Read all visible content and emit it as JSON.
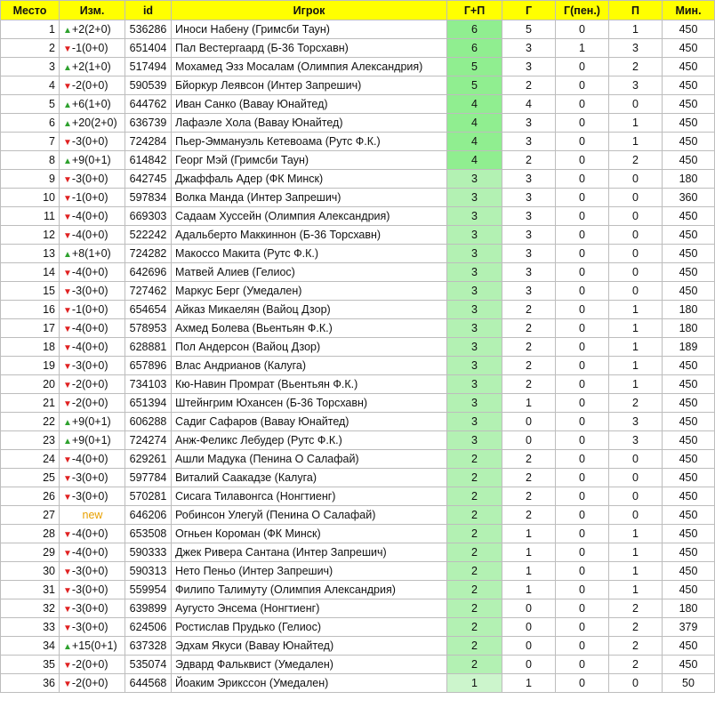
{
  "colors": {
    "header_bg": "#ffff00",
    "gp_high": "#90ee90",
    "gp_mid": "#b3f1b3",
    "gp_low": "#ccf5cc",
    "up": "#2ea12e",
    "down": "#e02020",
    "new": "#e8a000"
  },
  "headers": [
    "Место",
    "Изм.",
    "id",
    "Игрок",
    "Г+П",
    "Г",
    "Г(пен.)",
    "П",
    "Мин."
  ],
  "rows": [
    {
      "place": "1",
      "dir": "up",
      "chg": "+2(2+0)",
      "id": "536286",
      "player": "Иноси Набену (Гримсби Таун)",
      "gp": "6",
      "g": "5",
      "pen": "0",
      "a": "1",
      "min": "450"
    },
    {
      "place": "2",
      "dir": "down",
      "chg": "-1(0+0)",
      "id": "651404",
      "player": "Пал Вестергаард (Б-36 Торсхавн)",
      "gp": "6",
      "g": "3",
      "pen": "1",
      "a": "3",
      "min": "450"
    },
    {
      "place": "3",
      "dir": "up",
      "chg": "+2(1+0)",
      "id": "517494",
      "player": "Мохамед Эзз Мосалам (Олимпия Александрия)",
      "gp": "5",
      "g": "3",
      "pen": "0",
      "a": "2",
      "min": "450"
    },
    {
      "place": "4",
      "dir": "down",
      "chg": "-2(0+0)",
      "id": "590539",
      "player": "Бйоркур Леявсон (Интер Запрешич)",
      "gp": "5",
      "g": "2",
      "pen": "0",
      "a": "3",
      "min": "450"
    },
    {
      "place": "5",
      "dir": "up",
      "chg": "+6(1+0)",
      "id": "644762",
      "player": "Иван Санко (Вавау Юнайтед)",
      "gp": "4",
      "g": "4",
      "pen": "0",
      "a": "0",
      "min": "450"
    },
    {
      "place": "6",
      "dir": "up",
      "chg": "+20(2+0)",
      "id": "636739",
      "player": "Лафаэле Хола (Вавау Юнайтед)",
      "gp": "4",
      "g": "3",
      "pen": "0",
      "a": "1",
      "min": "450"
    },
    {
      "place": "7",
      "dir": "down",
      "chg": "-3(0+0)",
      "id": "724284",
      "player": "Пьер-Эммануэль Кетевоама (Рутс Ф.К.)",
      "gp": "4",
      "g": "3",
      "pen": "0",
      "a": "1",
      "min": "450"
    },
    {
      "place": "8",
      "dir": "up",
      "chg": "+9(0+1)",
      "id": "614842",
      "player": "Георг Мэй (Гримсби Таун)",
      "gp": "4",
      "g": "2",
      "pen": "0",
      "a": "2",
      "min": "450"
    },
    {
      "place": "9",
      "dir": "down",
      "chg": "-3(0+0)",
      "id": "642745",
      "player": "Джаффаль Адер (ФК Минск)",
      "gp": "3",
      "g": "3",
      "pen": "0",
      "a": "0",
      "min": "180"
    },
    {
      "place": "10",
      "dir": "down",
      "chg": "-1(0+0)",
      "id": "597834",
      "player": "Волка Манда (Интер Запрешич)",
      "gp": "3",
      "g": "3",
      "pen": "0",
      "a": "0",
      "min": "360"
    },
    {
      "place": "11",
      "dir": "down",
      "chg": "-4(0+0)",
      "id": "669303",
      "player": "Садаам Хуссейн (Олимпия Александрия)",
      "gp": "3",
      "g": "3",
      "pen": "0",
      "a": "0",
      "min": "450"
    },
    {
      "place": "12",
      "dir": "down",
      "chg": "-4(0+0)",
      "id": "522242",
      "player": "Адальберто Маккиннон (Б-36 Торсхавн)",
      "gp": "3",
      "g": "3",
      "pen": "0",
      "a": "0",
      "min": "450"
    },
    {
      "place": "13",
      "dir": "up",
      "chg": "+8(1+0)",
      "id": "724282",
      "player": "Макоссо Макита (Рутс Ф.К.)",
      "gp": "3",
      "g": "3",
      "pen": "0",
      "a": "0",
      "min": "450"
    },
    {
      "place": "14",
      "dir": "down",
      "chg": "-4(0+0)",
      "id": "642696",
      "player": "Матвей Алиев (Гелиос)",
      "gp": "3",
      "g": "3",
      "pen": "0",
      "a": "0",
      "min": "450"
    },
    {
      "place": "15",
      "dir": "down",
      "chg": "-3(0+0)",
      "id": "727462",
      "player": "Маркус Берг (Умедален)",
      "gp": "3",
      "g": "3",
      "pen": "0",
      "a": "0",
      "min": "450"
    },
    {
      "place": "16",
      "dir": "down",
      "chg": "-1(0+0)",
      "id": "654654",
      "player": "Айказ Микаелян (Вайоц Дзор)",
      "gp": "3",
      "g": "2",
      "pen": "0",
      "a": "1",
      "min": "180"
    },
    {
      "place": "17",
      "dir": "down",
      "chg": "-4(0+0)",
      "id": "578953",
      "player": "Ахмед Болева (Вьентьян Ф.К.)",
      "gp": "3",
      "g": "2",
      "pen": "0",
      "a": "1",
      "min": "180"
    },
    {
      "place": "18",
      "dir": "down",
      "chg": "-4(0+0)",
      "id": "628881",
      "player": "Пол Андерсон (Вайоц Дзор)",
      "gp": "3",
      "g": "2",
      "pen": "0",
      "a": "1",
      "min": "189"
    },
    {
      "place": "19",
      "dir": "down",
      "chg": "-3(0+0)",
      "id": "657896",
      "player": "Влас Андрианов (Калуга)",
      "gp": "3",
      "g": "2",
      "pen": "0",
      "a": "1",
      "min": "450"
    },
    {
      "place": "20",
      "dir": "down",
      "chg": "-2(0+0)",
      "id": "734103",
      "player": "Кю-Навин Промрат (Вьентьян Ф.К.)",
      "gp": "3",
      "g": "2",
      "pen": "0",
      "a": "1",
      "min": "450"
    },
    {
      "place": "21",
      "dir": "down",
      "chg": "-2(0+0)",
      "id": "651394",
      "player": "Штейнгрим Юхансен (Б-36 Торсхавн)",
      "gp": "3",
      "g": "1",
      "pen": "0",
      "a": "2",
      "min": "450"
    },
    {
      "place": "22",
      "dir": "up",
      "chg": "+9(0+1)",
      "id": "606288",
      "player": "Садиг Сафаров (Вавау Юнайтед)",
      "gp": "3",
      "g": "0",
      "pen": "0",
      "a": "3",
      "min": "450"
    },
    {
      "place": "23",
      "dir": "up",
      "chg": "+9(0+1)",
      "id": "724274",
      "player": "Анж-Феликс Лебудер (Рутс Ф.К.)",
      "gp": "3",
      "g": "0",
      "pen": "0",
      "a": "3",
      "min": "450"
    },
    {
      "place": "24",
      "dir": "down",
      "chg": "-4(0+0)",
      "id": "629261",
      "player": "Ашли Мадука (Пенина О Салафай)",
      "gp": "2",
      "g": "2",
      "pen": "0",
      "a": "0",
      "min": "450"
    },
    {
      "place": "25",
      "dir": "down",
      "chg": "-3(0+0)",
      "id": "597784",
      "player": "Виталий Саакадзе (Калуга)",
      "gp": "2",
      "g": "2",
      "pen": "0",
      "a": "0",
      "min": "450"
    },
    {
      "place": "26",
      "dir": "down",
      "chg": "-3(0+0)",
      "id": "570281",
      "player": "Сисага Тилавонгса (Нонгтиенг)",
      "gp": "2",
      "g": "2",
      "pen": "0",
      "a": "0",
      "min": "450"
    },
    {
      "place": "27",
      "dir": "new",
      "chg": "new",
      "id": "646206",
      "player": "Робинсон Улегуй (Пенина О Салафай)",
      "gp": "2",
      "g": "2",
      "pen": "0",
      "a": "0",
      "min": "450"
    },
    {
      "place": "28",
      "dir": "down",
      "chg": "-4(0+0)",
      "id": "653508",
      "player": "Огньен Короман (ФК Минск)",
      "gp": "2",
      "g": "1",
      "pen": "0",
      "a": "1",
      "min": "450"
    },
    {
      "place": "29",
      "dir": "down",
      "chg": "-4(0+0)",
      "id": "590333",
      "player": "Джек Ривера Сантана (Интер Запрешич)",
      "gp": "2",
      "g": "1",
      "pen": "0",
      "a": "1",
      "min": "450"
    },
    {
      "place": "30",
      "dir": "down",
      "chg": "-3(0+0)",
      "id": "590313",
      "player": "Нето Пеньо (Интер Запрешич)",
      "gp": "2",
      "g": "1",
      "pen": "0",
      "a": "1",
      "min": "450"
    },
    {
      "place": "31",
      "dir": "down",
      "chg": "-3(0+0)",
      "id": "559954",
      "player": "Филипо Талимуту (Олимпия Александрия)",
      "gp": "2",
      "g": "1",
      "pen": "0",
      "a": "1",
      "min": "450"
    },
    {
      "place": "32",
      "dir": "down",
      "chg": "-3(0+0)",
      "id": "639899",
      "player": "Аугусто Энсема (Нонгтиенг)",
      "gp": "2",
      "g": "0",
      "pen": "0",
      "a": "2",
      "min": "180"
    },
    {
      "place": "33",
      "dir": "down",
      "chg": "-3(0+0)",
      "id": "624506",
      "player": "Ростислав Прудько (Гелиос)",
      "gp": "2",
      "g": "0",
      "pen": "0",
      "a": "2",
      "min": "379"
    },
    {
      "place": "34",
      "dir": "up",
      "chg": "+15(0+1)",
      "id": "637328",
      "player": "Эдхам Якуси (Вавау Юнайтед)",
      "gp": "2",
      "g": "0",
      "pen": "0",
      "a": "2",
      "min": "450"
    },
    {
      "place": "35",
      "dir": "down",
      "chg": "-2(0+0)",
      "id": "535074",
      "player": "Эдвард Фальквист (Умедален)",
      "gp": "2",
      "g": "0",
      "pen": "0",
      "a": "2",
      "min": "450"
    },
    {
      "place": "36",
      "dir": "down",
      "chg": "-2(0+0)",
      "id": "644568",
      "player": "Йоаким Эрикссон (Умедален)",
      "gp": "1",
      "g": "1",
      "pen": "0",
      "a": "0",
      "min": "50"
    }
  ]
}
